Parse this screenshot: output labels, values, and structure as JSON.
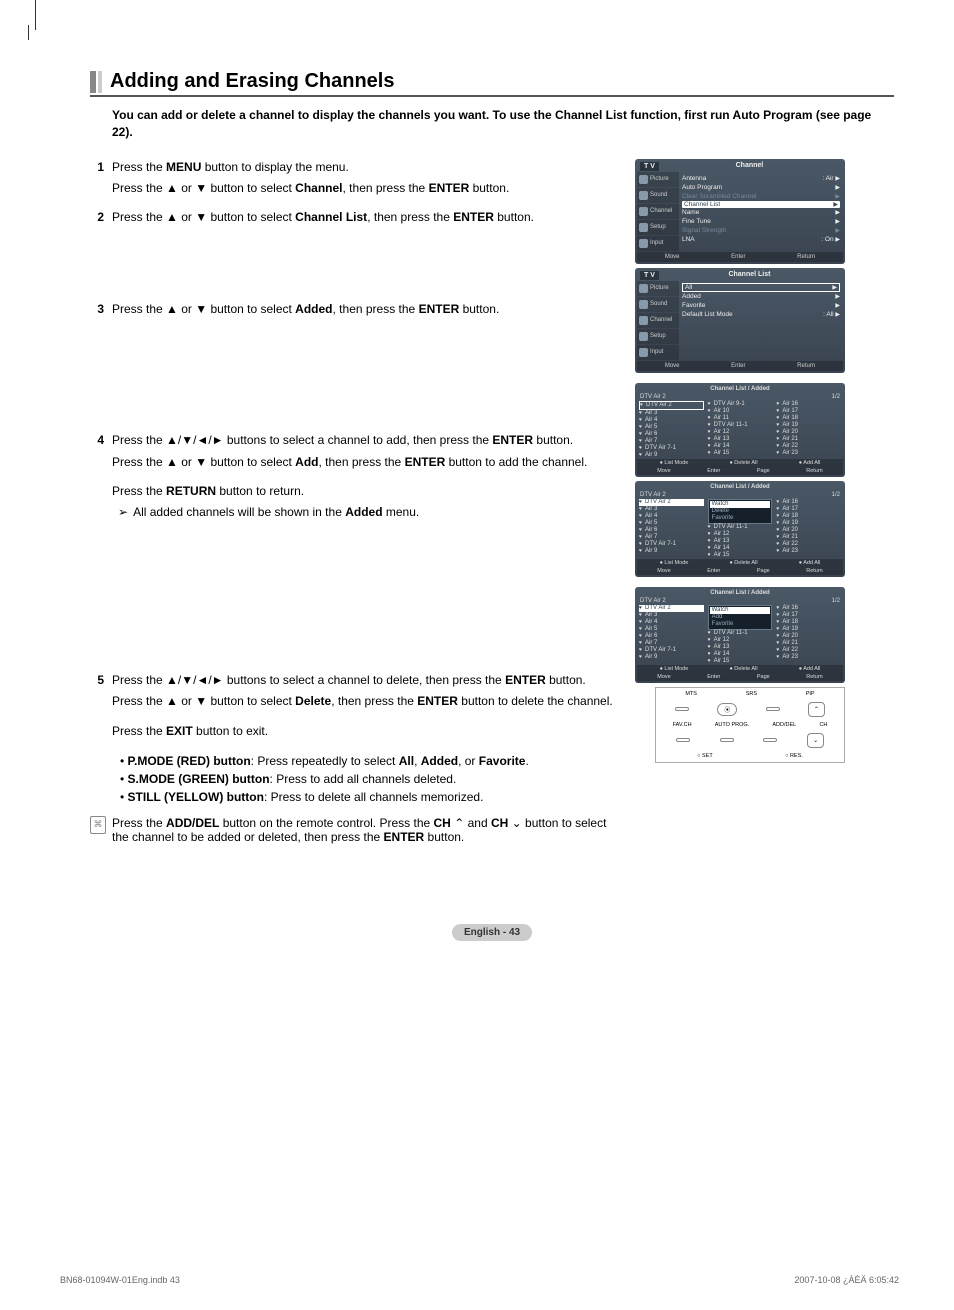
{
  "heading": "Adding and Erasing Channels",
  "intro": "You can add or delete a channel to display the channels you want. To use the Channel List function, first run Auto Program (see page 22).",
  "steps": {
    "s1": {
      "num": "1",
      "l1a": "Press the ",
      "l1b": "MENU",
      "l1c": " button to display the menu.",
      "l2a": "Press the ▲ or ▼ button to select ",
      "l2b": "Channel",
      "l2c": ", then press the ",
      "l2d": "ENTER",
      "l2e": " button."
    },
    "s2": {
      "num": "2",
      "l1a": "Press the ▲ or ▼ button to select ",
      "l1b": "Channel List",
      "l1c": ", then press the ",
      "l1d": "ENTER",
      "l1e": " button."
    },
    "s3": {
      "num": "3",
      "l1a": "Press the ▲ or ▼ button to select ",
      "l1b": "Added",
      "l1c": ", then press the ",
      "l1d": "ENTER",
      "l1e": " button."
    },
    "s4": {
      "num": "4",
      "l1a": "Press the ▲/▼/◄/► buttons to select a channel to add, then press the ",
      "l1b": "ENTER",
      "l1c": " button.",
      "l2a": "Press the ▲ or ▼ button to select ",
      "l2b": "Add",
      "l2c": ", then press the ",
      "l2d": "ENTER",
      "l2e": " button to add the channel.",
      "l3a": "Press the ",
      "l3b": "RETURN",
      "l3c": " button to return.",
      "note": "All added channels will be shown in the ",
      "noteb": "Added",
      "notec": " menu."
    },
    "s5": {
      "num": "5",
      "l1a": "Press the ▲/▼/◄/► buttons to select a channel to delete, then press the ",
      "l1b": "ENTER",
      "l1c": " button.",
      "l2a": "Press the ▲ or ▼ button to select ",
      "l2b": "Delete",
      "l2c": ", then press the ",
      "l2d": "ENTER",
      "l2e": " button to delete the channel.",
      "l3a": "Press the ",
      "l3b": "EXIT",
      "l3c": " button to exit."
    }
  },
  "buttonNotes": {
    "n1a": "P.MODE (RED) button",
    "n1b": ": Press repeatedly to select ",
    "n1c": "All",
    "n1d": ", ",
    "n1e": "Added",
    "n1f": ", or ",
    "n1g": "Favorite",
    "n1h": ".",
    "n2a": "S.MODE (GREEN) button",
    "n2b": ": Press to add all channels deleted.",
    "n3a": "STILL (YELLOW) button",
    "n3b": ": Press to delete all channels memorized."
  },
  "remoteNote": {
    "a": "Press the ",
    "b": "ADD/DEL",
    "c": " button on the remote control. Press the ",
    "d": "CH",
    "e": " and ",
    "f": "CH",
    "g": " button to select the channel to be added or deleted, then press the ",
    "h": "ENTER",
    "i": " button."
  },
  "tv_menu1": {
    "title_left": "T V",
    "title_mid": "Channel",
    "sidebar": [
      "Picture",
      "Sound",
      "Channel",
      "Setup",
      "Input"
    ],
    "rows": [
      {
        "label": "Antenna",
        "val": ": Air"
      },
      {
        "label": "Auto Program",
        "val": ""
      },
      {
        "label": "Clear Scrambled Channel",
        "val": "",
        "dim": true
      },
      {
        "label": "Channel List",
        "val": "",
        "hl": true
      },
      {
        "label": "Name",
        "val": ""
      },
      {
        "label": "Fine Tune",
        "val": ""
      },
      {
        "label": "Signal Strength",
        "val": "",
        "dim": true
      },
      {
        "label": "LNA",
        "val": ": On"
      }
    ],
    "footer": [
      "Move",
      "Enter",
      "Return"
    ]
  },
  "tv_menu2": {
    "title_left": "T V",
    "title_mid": "Channel List",
    "rows": [
      {
        "label": "All",
        "hl": true
      },
      {
        "label": "Added"
      },
      {
        "label": "Favorite"
      },
      {
        "label": "Default List Mode",
        "val": ": All"
      }
    ],
    "footer": [
      "Move",
      "Enter",
      "Return"
    ]
  },
  "chlist1": {
    "title": "Channel List / Added",
    "sub": "DTV Air 2",
    "page": "1/2",
    "col1": [
      "DTV Air 2",
      "Air 3",
      "Air 4",
      "Air 5",
      "Air 6",
      "Air 7",
      "DTV Air 7-1",
      "Air 9"
    ],
    "col2": [
      "DTV Air 9-1",
      "Air 10",
      "Air 11",
      "DTV Air 11-1",
      "Air 12",
      "Air 13",
      "Air 14",
      "Air 15"
    ],
    "col3": [
      "Air 16",
      "Air 17",
      "Air 18",
      "Air 19",
      "Air 20",
      "Air 21",
      "Air 22",
      "Air 23"
    ],
    "bar1": [
      "List Mode",
      "Delete All",
      "Add All"
    ],
    "bar2": [
      "Move",
      "Enter",
      "Page",
      "Return"
    ]
  },
  "chlist2_popup": {
    "title": "Channel List / Added",
    "items": [
      "Watch",
      "Delete",
      "Favorite"
    ]
  },
  "chlist3_popup": {
    "title": "Channel List / Added",
    "items": [
      "Watch",
      "Add",
      "Favorite"
    ]
  },
  "remote_fig": {
    "top": [
      "MTS",
      "SRS",
      "PIP"
    ],
    "mid": [
      "FAV.CH",
      "AUTO PROG.",
      "ADD/DEL"
    ],
    "ch": "CH",
    "bot": [
      "SET",
      "RES."
    ]
  },
  "pageLabel": "English - 43",
  "footer": {
    "left": "BN68-01094W-01Eng.indb   43",
    "right": "2007-10-08   ¿ÀÈÄ 6:05:42"
  }
}
